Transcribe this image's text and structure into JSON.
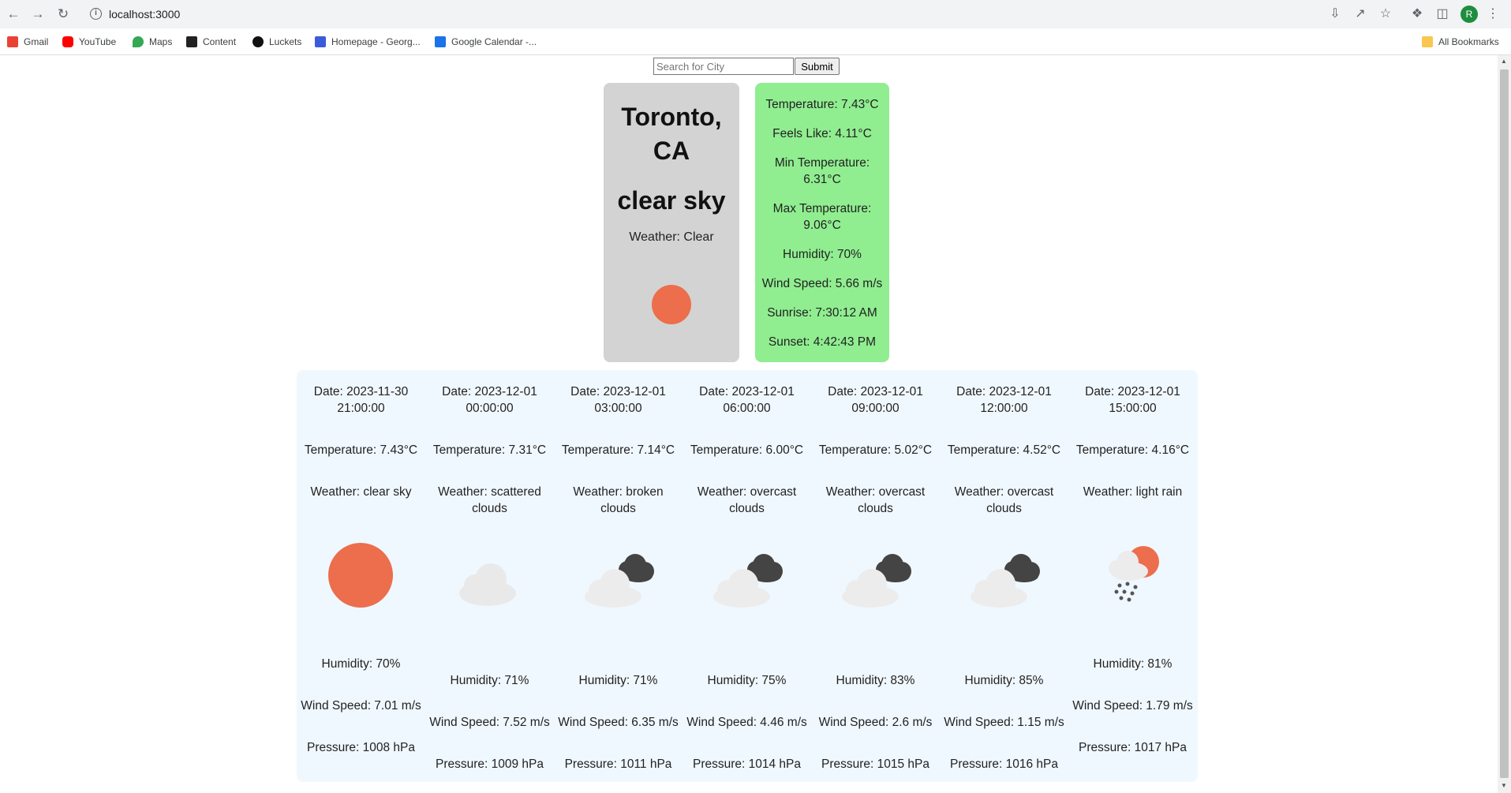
{
  "browser": {
    "url": "localhost:3000",
    "avatar_letter": "R",
    "bookmarks": [
      "Gmail",
      "YouTube",
      "Maps",
      "Content",
      "Luckets",
      "Homepage - Georg...",
      "Google Calendar -..."
    ],
    "all_bookmarks": "All Bookmarks"
  },
  "search": {
    "placeholder": "Search for City",
    "submit": "Submit"
  },
  "current": {
    "city": "Toronto, CA",
    "description": "clear sky",
    "weather": "Weather: Clear",
    "icon": "sun-icon",
    "stats": {
      "temperature": "Temperature: 7.43°C",
      "feels_like": "Feels Like: 4.11°C",
      "min_temp": "Min Temperature: 6.31°C",
      "max_temp": "Max Temperature: 9.06°C",
      "humidity": "Humidity: 70%",
      "wind": "Wind Speed: 5.66 m/s",
      "sunrise": "Sunrise: 7:30:12 AM",
      "sunset": "Sunset: 4:42:43 PM"
    }
  },
  "forecast": [
    {
      "date": "Date: 2023-11-30 21:00:00",
      "temp": "Temperature: 7.43°C",
      "weather": "Weather: clear sky",
      "icon": "clear-sky-icon",
      "humidity": "Humidity: 70%",
      "wind": "Wind Speed: 7.01 m/s",
      "pressure": "Pressure: 1008 hPa"
    },
    {
      "date": "Date: 2023-12-01 00:00:00",
      "temp": "Temperature: 7.31°C",
      "weather": "Weather: scattered clouds",
      "icon": "scattered-clouds-icon",
      "humidity": "Humidity: 71%",
      "wind": "Wind Speed: 7.52 m/s",
      "pressure": "Pressure: 1009 hPa"
    },
    {
      "date": "Date: 2023-12-01 03:00:00",
      "temp": "Temperature: 7.14°C",
      "weather": "Weather: broken clouds",
      "icon": "broken-clouds-icon",
      "humidity": "Humidity: 71%",
      "wind": "Wind Speed: 6.35 m/s",
      "pressure": "Pressure: 1011 hPa"
    },
    {
      "date": "Date: 2023-12-01 06:00:00",
      "temp": "Temperature: 6.00°C",
      "weather": "Weather: overcast clouds",
      "icon": "overcast-clouds-icon",
      "humidity": "Humidity: 75%",
      "wind": "Wind Speed: 4.46 m/s",
      "pressure": "Pressure: 1014 hPa"
    },
    {
      "date": "Date: 2023-12-01 09:00:00",
      "temp": "Temperature: 5.02°C",
      "weather": "Weather: overcast clouds",
      "icon": "overcast-clouds-icon",
      "humidity": "Humidity: 83%",
      "wind": "Wind Speed: 2.6 m/s",
      "pressure": "Pressure: 1015 hPa"
    },
    {
      "date": "Date: 2023-12-01 12:00:00",
      "temp": "Temperature: 4.52°C",
      "weather": "Weather: overcast clouds",
      "icon": "overcast-clouds-icon",
      "humidity": "Humidity: 85%",
      "wind": "Wind Speed: 1.15 m/s",
      "pressure": "Pressure: 1016 hPa"
    },
    {
      "date": "Date: 2023-12-01 15:00:00",
      "temp": "Temperature: 4.16°C",
      "weather": "Weather: light rain",
      "icon": "light-rain-icon",
      "humidity": "Humidity: 81%",
      "wind": "Wind Speed: 1.79 m/s",
      "pressure": "Pressure: 1017 hPa"
    }
  ],
  "colors": {
    "city_card": "#d3d3d3",
    "stats_card": "#90ee90",
    "forecast_bg": "#f0f8ff",
    "sun": "#ec6e4c"
  }
}
